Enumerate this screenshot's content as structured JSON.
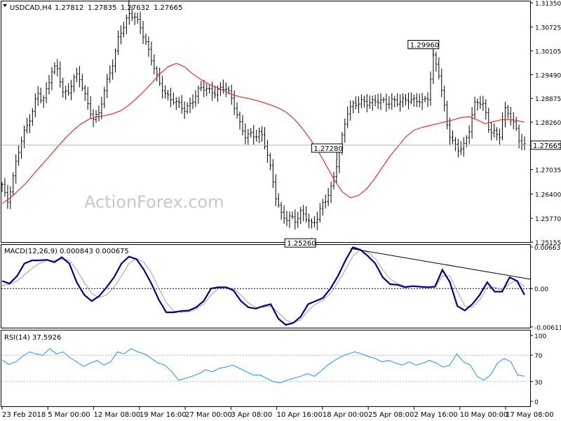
{
  "chart_data": {
    "type": "line",
    "symbol": "USDCAD,H4",
    "ohlc": [
      "1.27812",
      "1.27835",
      "1.27632",
      "1.27665"
    ],
    "watermark": "ActionForex.com",
    "current_price": "1.27665",
    "price_axis": {
      "ylim": [
        1.25155,
        1.3135
      ],
      "ticks": [
        "1.31350",
        "1.30725",
        "1.30105",
        "1.29490",
        "1.28875",
        "1.28260",
        "1.27035",
        "1.26400",
        "1.25770",
        "1.25155"
      ]
    },
    "x_ticks": [
      "23 Feb 2018",
      "5 Mar 00:00",
      "12 Mar 08:00",
      "19 Mar 16:00",
      "27 Mar 00:00",
      "3 Apr 08:00",
      "10 Apr 16:00",
      "18 Apr 00:00",
      "25 Apr 08:00",
      "2 May 16:00",
      "10 May 00:00",
      "17 May 08:00"
    ],
    "price_labels": [
      {
        "text": "1.31240",
        "value": 1.3124
      },
      {
        "text": "1.29960",
        "value": 1.2996
      },
      {
        "text": "1.27280",
        "value": 1.2728
      },
      {
        "text": "1.25260",
        "value": 1.2526
      }
    ],
    "price_series": [
      1.2665,
      1.2615,
      1.2672,
      1.2738,
      1.279,
      1.2818,
      1.2855,
      1.2902,
      1.288,
      1.2918,
      1.297,
      1.296,
      1.2905,
      1.2898,
      1.294,
      1.2948,
      1.2912,
      1.2865,
      1.2835,
      1.2845,
      1.29,
      1.2945,
      1.2985,
      1.305,
      1.3075,
      1.3105,
      1.3102,
      1.308,
      1.3045,
      1.3005,
      1.2968,
      1.2925,
      1.2905,
      1.2885,
      1.2882,
      1.287,
      1.2858,
      1.287,
      1.2892,
      1.2915,
      1.2915,
      1.2905,
      1.2902,
      1.2912,
      1.2918,
      1.2895,
      1.286,
      1.2815,
      1.279,
      1.2795,
      1.279,
      1.28,
      1.276,
      1.27,
      1.263,
      1.2588,
      1.2575,
      1.258,
      1.257,
      1.2595,
      1.2578,
      1.256,
      1.2575,
      1.261,
      1.263,
      1.266,
      1.272,
      1.2785,
      1.285,
      1.287,
      1.2875,
      1.288,
      1.2875,
      1.2878,
      1.2882,
      1.288,
      1.2875,
      1.2882,
      1.2878,
      1.2882,
      1.2885,
      1.2882,
      1.2883,
      1.288,
      1.289,
      1.2995,
      1.296,
      1.288,
      1.28,
      1.277,
      1.2755,
      1.2765,
      1.28,
      1.287,
      1.288,
      1.287,
      1.2805,
      1.28,
      1.2785,
      1.286,
      1.2845,
      1.282,
      1.2777,
      1.2766
    ],
    "ma_series": [
      1.2615,
      1.263,
      1.2648,
      1.2668,
      1.2692,
      1.2715,
      1.2738,
      1.2762,
      1.2785,
      1.2805,
      1.2822,
      1.2834,
      1.284,
      1.2843,
      1.2848,
      1.2856,
      1.287,
      1.2888,
      1.2908,
      1.293,
      1.2952,
      1.297,
      1.2978,
      1.297,
      1.2952,
      1.2938,
      1.2926,
      1.2916,
      1.2908,
      1.2898,
      1.2892,
      1.2888,
      1.2883,
      1.2877,
      1.287,
      1.2862,
      1.285,
      1.2832,
      1.2808,
      1.278,
      1.2748,
      1.2712,
      1.2675,
      1.2645,
      1.263,
      1.2636,
      1.2652,
      1.2678,
      1.2708,
      1.2738,
      1.2763,
      1.2788,
      1.2805,
      1.2812,
      1.2817,
      1.2822,
      1.2827,
      1.2832,
      1.2838,
      1.284,
      1.2832,
      1.2822,
      1.2827,
      1.2832,
      1.2833,
      1.283,
      1.2826
    ],
    "macd": {
      "label": "MACD(12,26,9) 0.000843 0.000675",
      "ylim": [
        -0.00614,
        0.00664
      ],
      "ticks": [
        "0.006639",
        "0.00",
        "-0.006114"
      ],
      "macd_series": [
        0.0012,
        0.0008,
        0.002,
        0.004,
        0.0045,
        0.0045,
        0.0046,
        0.0042,
        0.005,
        0.004,
        0.001,
        -0.001,
        -0.002,
        -0.0012,
        0.0002,
        0.0018,
        0.004,
        0.0051,
        0.0047,
        0.003,
        0.0008,
        -0.0018,
        -0.0038,
        -0.0038,
        -0.0036,
        -0.0035,
        -0.003,
        -0.002,
        0.0,
        0.0002,
        0.0002,
        -0.0003,
        -0.002,
        -0.003,
        -0.0032,
        -0.0028,
        -0.0025,
        -0.0048,
        -0.0058,
        -0.0055,
        -0.0045,
        -0.0025,
        -0.002,
        -0.0015,
        0.0,
        0.002,
        0.0045,
        0.0066,
        0.0062,
        0.0052,
        0.004,
        0.0018,
        0.0007,
        0.0006,
        0.0002,
        0.0004,
        0.0003,
        0.0002,
        0.0003,
        0.003,
        0.001,
        -0.0028,
        -0.0035,
        -0.0025,
        -0.001,
        0.001,
        -0.0005,
        -0.0005,
        0.0018,
        0.0012,
        -0.001
      ],
      "signal_series": [
        0.0005,
        0.0007,
        0.0012,
        0.0022,
        0.0032,
        0.004,
        0.0045,
        0.0045,
        0.0047,
        0.0045,
        0.003,
        0.001,
        -0.0008,
        -0.0015,
        -0.001,
        0.0002,
        0.002,
        0.004,
        0.0048,
        0.0042,
        0.0025,
        0.0,
        -0.0022,
        -0.0036,
        -0.0038,
        -0.0037,
        -0.0033,
        -0.0025,
        -0.001,
        0.0,
        0.0002,
        0.0,
        -0.001,
        -0.0023,
        -0.003,
        -0.003,
        -0.0028,
        -0.0038,
        -0.005,
        -0.0055,
        -0.005,
        -0.0035,
        -0.0025,
        -0.0018,
        -0.0008,
        0.001,
        0.003,
        0.0052,
        0.0062,
        0.0058,
        0.0048,
        0.003,
        0.0015,
        0.0008,
        0.0004,
        0.0004,
        0.0003,
        0.0002,
        0.0002,
        0.002,
        0.002,
        -0.0005,
        -0.0028,
        -0.003,
        -0.0018,
        0.0002,
        0.0002,
        -0.0003,
        0.0008,
        0.0013,
        0.0003
      ],
      "trendline": [
        0.0064,
        0.0015
      ]
    },
    "rsi": {
      "label": "RSI(14) 37.5926",
      "ylim": [
        0,
        100
      ],
      "ticks": [
        "100",
        "70",
        "30",
        "0"
      ],
      "levels": [
        70,
        30
      ],
      "series": [
        63,
        56,
        60,
        68,
        75,
        72,
        70,
        80,
        72,
        75,
        66,
        60,
        53,
        58,
        62,
        55,
        60,
        75,
        72,
        80,
        75,
        72,
        65,
        58,
        55,
        45,
        32,
        35,
        38,
        42,
        48,
        45,
        50,
        52,
        55,
        50,
        45,
        40,
        40,
        35,
        30,
        28,
        32,
        35,
        38,
        42,
        38,
        46,
        55,
        62,
        68,
        72,
        75,
        72,
        68,
        65,
        60,
        62,
        58,
        55,
        60,
        55,
        58,
        62,
        58,
        52,
        55,
        72,
        60,
        55,
        38,
        32,
        40,
        58,
        65,
        60,
        40,
        38
      ]
    }
  }
}
